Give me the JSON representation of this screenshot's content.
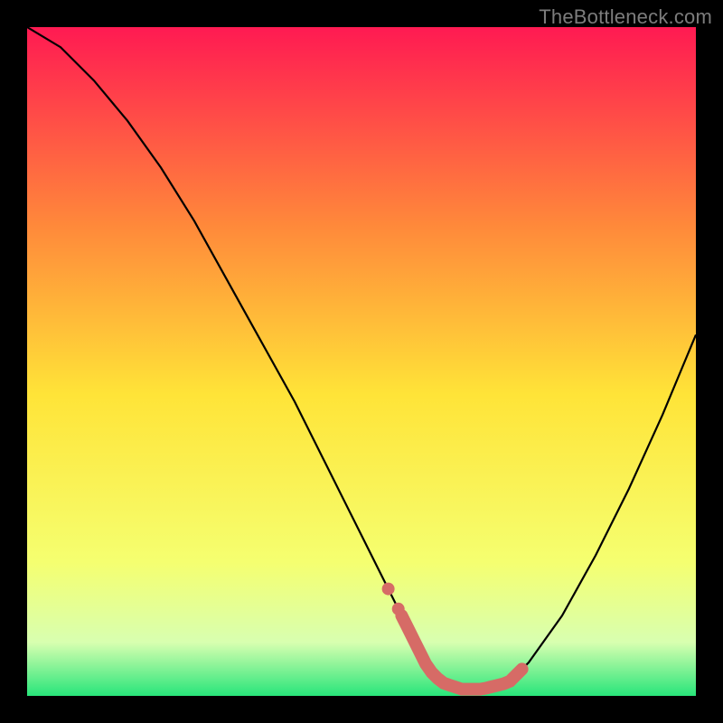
{
  "watermark": "TheBottleneck.com",
  "colors": {
    "bg": "#000000",
    "curve": "#000000",
    "hotspot": "#d66b66",
    "grad_top": "#ff1a52",
    "grad_mid1": "#ff8a3a",
    "grad_mid2": "#ffe438",
    "grad_mid3": "#f5ff70",
    "grad_mid4": "#d8ffb0",
    "grad_bot": "#28e57a"
  },
  "chart_data": {
    "type": "line",
    "title": "",
    "xlabel": "",
    "ylabel": "",
    "xlim": [
      0,
      100
    ],
    "ylim": [
      0,
      100
    ],
    "series": [
      {
        "name": "bottleneck-curve",
        "x": [
          0,
          5,
          10,
          15,
          20,
          25,
          30,
          35,
          40,
          45,
          50,
          55,
          58,
          60,
          62,
          65,
          68,
          72,
          75,
          80,
          85,
          90,
          95,
          100
        ],
        "values": [
          100,
          97,
          92,
          86,
          79,
          71,
          62,
          53,
          44,
          34,
          24,
          14,
          8,
          4,
          2,
          1,
          1,
          2,
          5,
          12,
          21,
          31,
          42,
          54
        ]
      }
    ],
    "hotspot_range_x": [
      56,
      74
    ],
    "annotations": []
  }
}
